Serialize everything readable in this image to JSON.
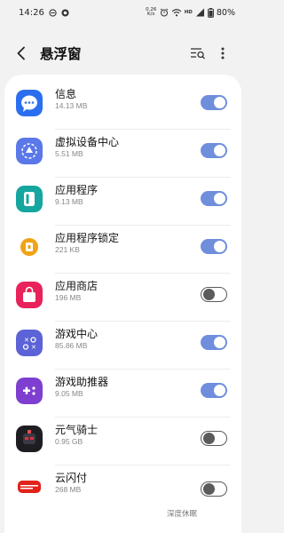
{
  "status_bar": {
    "time": "14:26",
    "net_speed_value": "0.26",
    "net_speed_unit": "K/s",
    "battery": "80%"
  },
  "header": {
    "title": "悬浮窗",
    "back_icon": "back-arrow-icon",
    "search_icon": "search-list-icon",
    "more_icon": "more-vertical-icon"
  },
  "apps": [
    {
      "name": "信息",
      "size": "14.13 MB",
      "enabled": true,
      "icon": "messages-icon"
    },
    {
      "name": "虚拟设备中心",
      "size": "5.51 MB",
      "enabled": true,
      "icon": "virtual-device-center-icon"
    },
    {
      "name": "应用程序",
      "size": "9.13 MB",
      "enabled": true,
      "icon": "applications-icon"
    },
    {
      "name": "应用程序锁定",
      "size": "221 KB",
      "enabled": true,
      "icon": "app-lock-icon"
    },
    {
      "name": "应用商店",
      "size": "196 MB",
      "enabled": false,
      "icon": "app-store-icon"
    },
    {
      "name": "游戏中心",
      "size": "85.86 MB",
      "enabled": true,
      "icon": "game-center-icon"
    },
    {
      "name": "游戏助推器",
      "size": "9.05 MB",
      "enabled": true,
      "icon": "game-booster-icon"
    },
    {
      "name": "元气骑士",
      "size": "0.95 GB",
      "enabled": false,
      "icon": "soul-knight-icon"
    },
    {
      "name": "云闪付",
      "size": "268 MB",
      "enabled": false,
      "icon": "unionpay-quickpass-icon"
    }
  ],
  "watermark": "深度休眠",
  "colors": {
    "toggle_on": "#6f8fdc",
    "toggle_off": "#5b5b5b",
    "background": "#f2f2f2",
    "card": "#ffffff"
  }
}
